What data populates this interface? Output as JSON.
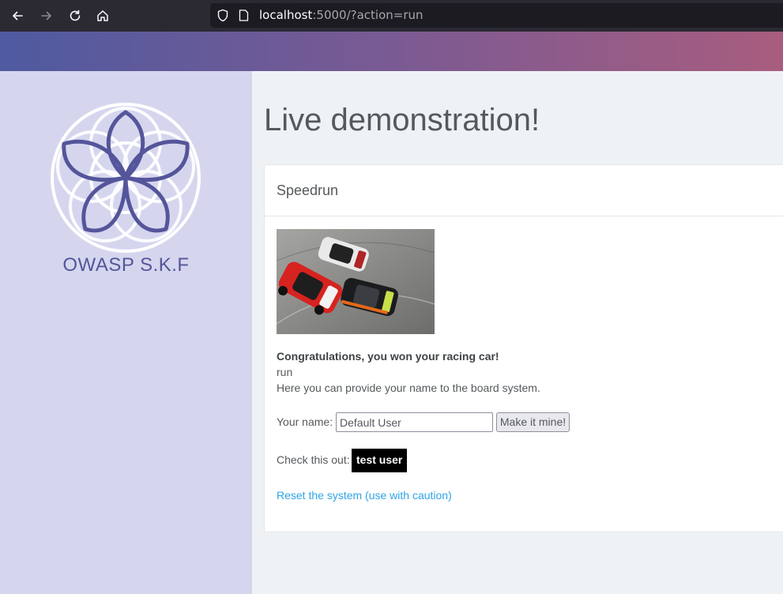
{
  "browser": {
    "url_host": "localhost",
    "url_rest": ":5000/?action=run"
  },
  "sidebar": {
    "logo_text": "OWASP S.K.F"
  },
  "main": {
    "title": "Live demonstration!",
    "card": {
      "header": "Speedrun",
      "congrats": "Congratulations, you won your racing car!",
      "action_echo": "run",
      "provide_text": "Here you can provide your name to the board system.",
      "name_label": "Your name:",
      "name_input_value": "Default User",
      "submit_label": "Make it mine!",
      "check_label": "Check this out:",
      "badge_text": "test user",
      "reset_link": "Reset the system (use with caution)"
    }
  },
  "colors": {
    "accent_link": "#2fa4e7",
    "logo_purple": "#54559a",
    "sidebar_bg": "#d5d6ee"
  },
  "icons": [
    "back-arrow-icon",
    "forward-arrow-icon",
    "reload-icon",
    "home-icon",
    "shield-icon",
    "page-icon"
  ]
}
